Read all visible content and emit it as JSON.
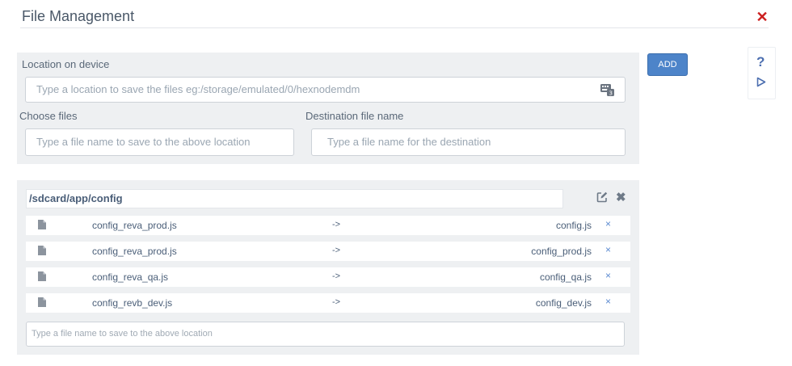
{
  "header": {
    "title": "File Management",
    "close_glyph": "✕"
  },
  "form": {
    "location_label": "Location on device",
    "location_placeholder": "Type a location to save the files eg:/storage/emulated/0/hexnodemdm",
    "location_value": "",
    "choose_files_label": "Choose files",
    "choose_files_placeholder": "Type a file name to save to the above location",
    "destination_label": "Destination file name",
    "destination_placeholder": "Type a file name for the destination",
    "add_button_label": "ADD",
    "keyboard_icon": "keyboard-icon"
  },
  "side_tools": {
    "help_glyph": "?",
    "play_icon": "play-icon"
  },
  "folder": {
    "path": "/sdcard/app/config",
    "arrow_text": "->",
    "remove_glyph": "×",
    "files": [
      {
        "source": "config_reva_prod.js",
        "destination": "config.js"
      },
      {
        "source": "config_reva_prod.js",
        "destination": "config_prod.js"
      },
      {
        "source": "config_reva_qa.js",
        "destination": "config_qa.js"
      },
      {
        "source": "config_revb_dev.js",
        "destination": "config_dev.js"
      }
    ],
    "add_file_placeholder": "Type a file name to save to the above location"
  },
  "colors": {
    "accent": "#4d84c9",
    "close": "#cc1f1f",
    "panel_bg": "#eef0f2"
  }
}
